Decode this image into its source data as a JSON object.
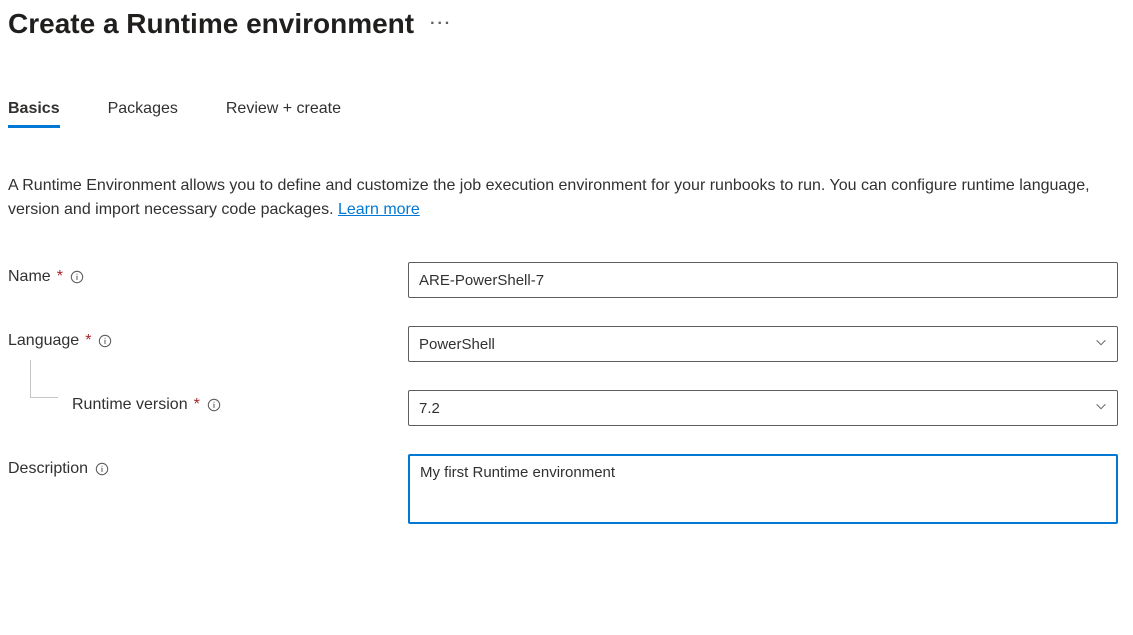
{
  "header": {
    "title": "Create a Runtime environment"
  },
  "tabs": [
    {
      "label": "Basics",
      "active": true
    },
    {
      "label": "Packages",
      "active": false
    },
    {
      "label": "Review + create",
      "active": false
    }
  ],
  "intro": {
    "text": "A Runtime Environment allows you to define and customize the job execution environment for your runbooks to run. You can configure runtime language, version and import necessary code packages. ",
    "link_label": "Learn more"
  },
  "fields": {
    "name": {
      "label": "Name",
      "required": true,
      "value": "ARE-PowerShell-7"
    },
    "language": {
      "label": "Language",
      "required": true,
      "value": "PowerShell"
    },
    "runtime_version": {
      "label": "Runtime version",
      "required": true,
      "value": "7.2"
    },
    "description": {
      "label": "Description",
      "required": false,
      "value": "My first Runtime environment"
    }
  }
}
